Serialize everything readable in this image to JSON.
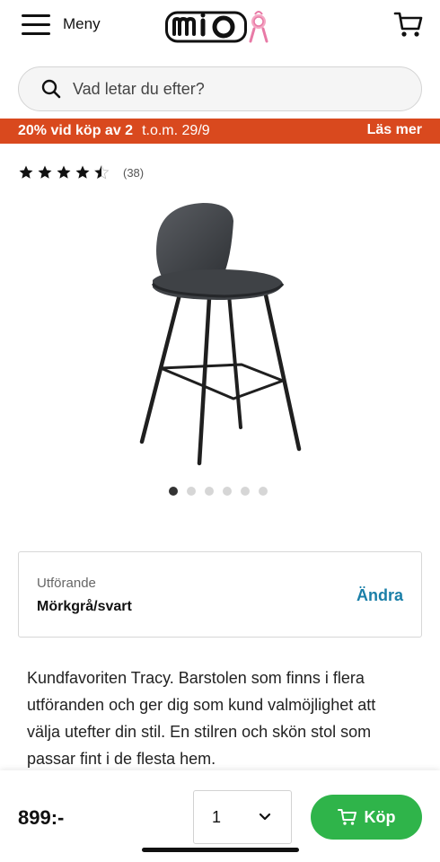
{
  "header": {
    "menu_label": "Meny",
    "logo_text": "mio"
  },
  "search": {
    "placeholder": "Vad letar du efter?"
  },
  "promo": {
    "main": "20% vid köp av 2",
    "sub": "t.o.m. 29/9",
    "link": "Läs mer",
    "color": "#d9491e"
  },
  "rating": {
    "stars": 4.5,
    "max": 5,
    "count": "(38)"
  },
  "product": {
    "image_icon": "bar-stool-image",
    "carousel": {
      "total": 6,
      "active": 1
    }
  },
  "variant": {
    "label": "Utförande",
    "value": "Mörkgrå/svart",
    "change_label": "Ändra"
  },
  "description": "Kundfavoriten Tracy. Barstolen som finns i flera utföranden och ger dig som kund valmöjlighet att välja utefter din stil. En stilren och skön stol som passar fint i de flesta hem.",
  "purchase": {
    "price": "899:-",
    "quantity": "1",
    "buy_label": "Köp",
    "buy_color": "#2fb44a"
  },
  "colors": {
    "accent_link": "#1a7fa8"
  }
}
